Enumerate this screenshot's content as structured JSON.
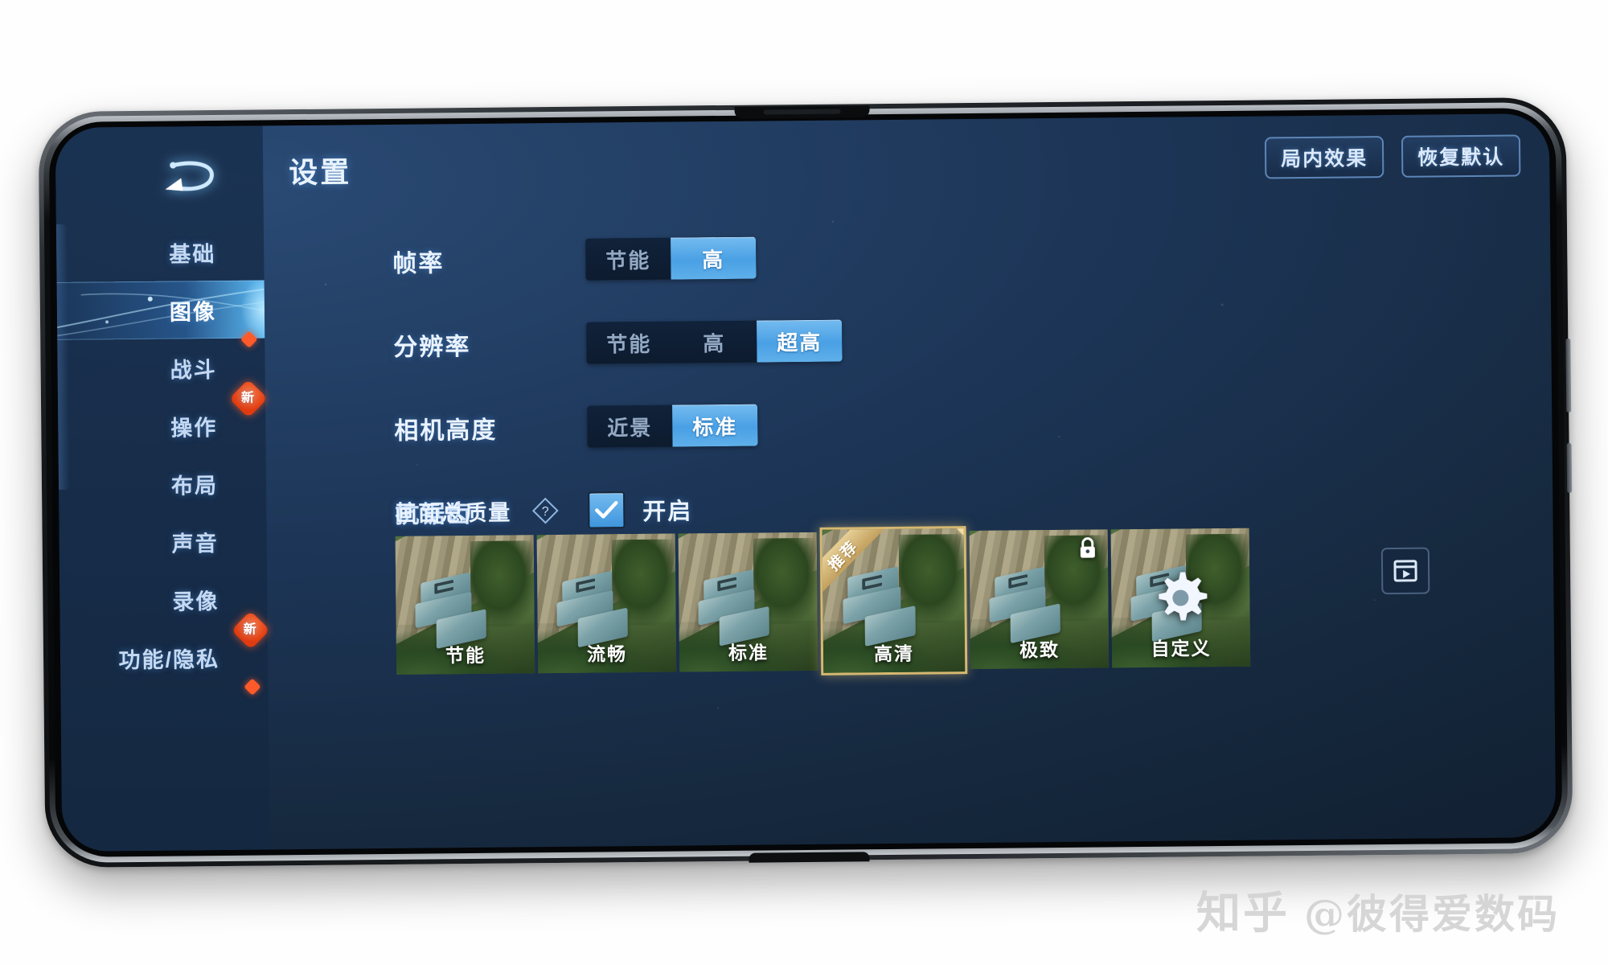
{
  "header": {
    "title": "设置",
    "back_icon": "back-arrow-icon",
    "actions": [
      {
        "label": "局内效果",
        "name": "in-game-effects-button"
      },
      {
        "label": "恢复默认",
        "name": "restore-defaults-button"
      }
    ]
  },
  "sidebar": {
    "items": [
      {
        "label": "基础",
        "active": false,
        "badge": ""
      },
      {
        "label": "图像",
        "active": true,
        "badge": ""
      },
      {
        "label": "战斗",
        "active": false,
        "badge": "dot"
      },
      {
        "label": "操作",
        "active": false,
        "badge": "新"
      },
      {
        "label": "布局",
        "active": false,
        "badge": ""
      },
      {
        "label": "声音",
        "active": false,
        "badge": ""
      },
      {
        "label": "录像",
        "active": false,
        "badge": ""
      },
      {
        "label": "功能/隐私",
        "active": false,
        "badge": "新"
      },
      {
        "label": "",
        "active": false,
        "badge": "dot"
      }
    ]
  },
  "settings": {
    "rows": [
      {
        "label": "帧率",
        "name": "frame-rate",
        "options": [
          {
            "label": "节能",
            "selected": false
          },
          {
            "label": "高",
            "selected": true
          }
        ]
      },
      {
        "label": "分辨率",
        "name": "resolution",
        "options": [
          {
            "label": "节能",
            "selected": false
          },
          {
            "label": "高",
            "selected": false
          },
          {
            "label": "超高",
            "selected": true
          }
        ]
      },
      {
        "label": "相机高度",
        "name": "camera-height",
        "options": [
          {
            "label": "近景",
            "selected": false
          },
          {
            "label": "标准",
            "selected": true
          }
        ]
      }
    ],
    "antialias": {
      "label": "抗锯齿",
      "help_icon": "question-diamond-icon",
      "checkbox_label": "开启",
      "checked": true
    }
  },
  "quality": {
    "title": "画面总质量",
    "cards": [
      {
        "label": "节能",
        "selected": false,
        "ribbon": "",
        "icon": ""
      },
      {
        "label": "流畅",
        "selected": false,
        "ribbon": "",
        "icon": ""
      },
      {
        "label": "标准",
        "selected": false,
        "ribbon": "",
        "icon": ""
      },
      {
        "label": "高清",
        "selected": true,
        "ribbon": "推荐",
        "icon": ""
      },
      {
        "label": "极致",
        "selected": false,
        "ribbon": "",
        "icon": "lock-icon"
      },
      {
        "label": "自定义",
        "selected": false,
        "ribbon": "",
        "icon": "gear-icon"
      }
    ],
    "preview_button": "video-preview-button"
  },
  "watermark": {
    "site": "知乎",
    "handle": "@彼得爱数码"
  },
  "colors": {
    "accent_blue": "#49a0e4",
    "selected_gold": "#d6b871",
    "badge_red": "#ff5a2a",
    "screen_bg": "#1d3658"
  }
}
